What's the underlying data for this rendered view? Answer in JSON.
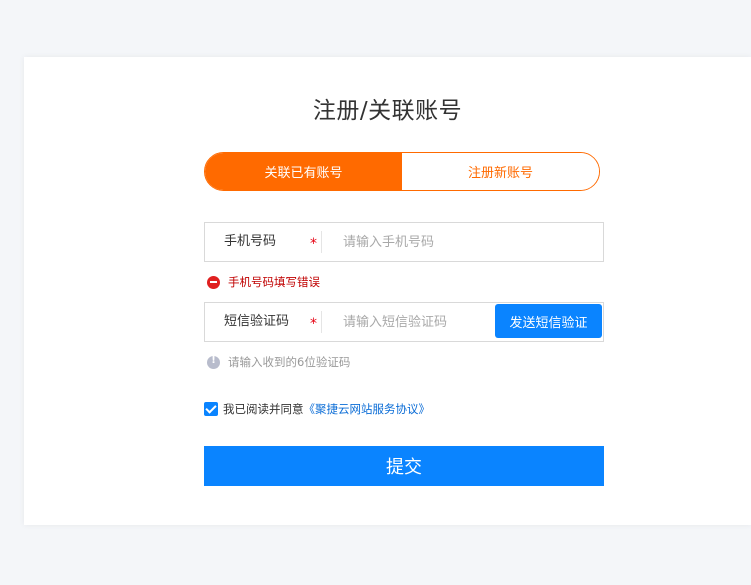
{
  "page": {
    "title": "注册/关联账号"
  },
  "tabs": [
    {
      "label": "关联已有账号",
      "active": true
    },
    {
      "label": "注册新账号",
      "active": false
    }
  ],
  "phone": {
    "label": "手机号码",
    "required_mark": "*",
    "value": "",
    "placeholder": "请输入手机号码",
    "error": "手机号码填写错误"
  },
  "sms": {
    "label": "短信验证码",
    "required_mark": "*",
    "value": "",
    "placeholder": "请输入短信验证码",
    "send_label": "发送短信验证",
    "hint": "请输入收到的6位验证码"
  },
  "agreement": {
    "checked": true,
    "text": "我已阅读并同意",
    "link": "《聚捷云网站服务协议》"
  },
  "submit": {
    "label": "提交"
  },
  "colors": {
    "accent_orange": "#ff6a00",
    "primary_blue": "#0a84ff",
    "error_red": "#e02020"
  },
  "icons": {
    "error": "error-circle-icon",
    "hint": "info-circle-icon",
    "checkbox": "check-icon"
  }
}
